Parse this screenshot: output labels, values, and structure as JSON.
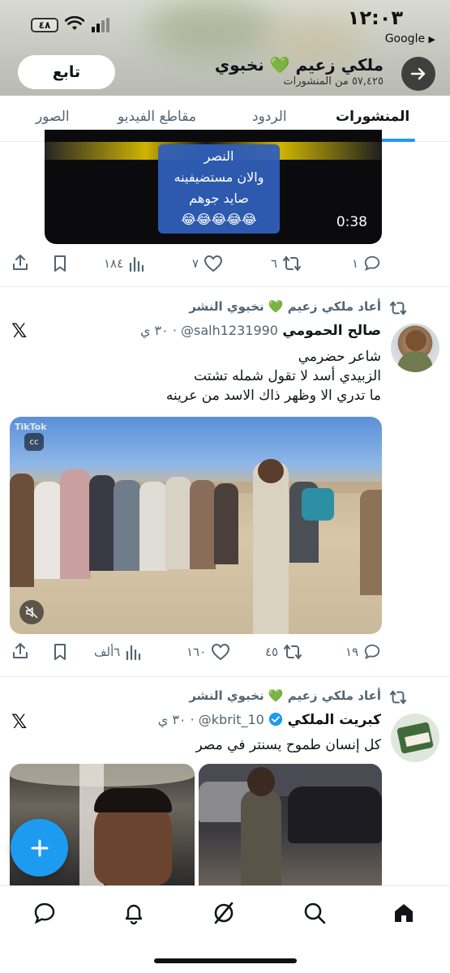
{
  "status_bar": {
    "time": "١٢:٠٣",
    "back_app": "Google",
    "battery": "٤٨"
  },
  "header": {
    "profile_name": "ملكي زعيم 💚 نخبوي",
    "post_count": "٥٧,٤٢٥ من المنشورات",
    "follow_label": "تابع"
  },
  "tabs": [
    {
      "label": "المنشورات",
      "active": true
    },
    {
      "label": "الردود"
    },
    {
      "label": "مقاطع الفيديو"
    },
    {
      "label": "الصور"
    }
  ],
  "post1": {
    "video_caption_lines": [
      "النصر",
      "والان مستضيفينه",
      "صايد جوهم",
      "😂😂😂😂😂"
    ],
    "video_duration": "0:38",
    "replies": "١",
    "reposts": "٦",
    "likes": "٧",
    "views": "١٨٤"
  },
  "post2": {
    "repost_label": "أعاد ملكي زعيم 💚 نخبوي النشر",
    "author_name": "صالح الحمومي",
    "handle_time": "‎@salh1231990 · ٣٠ ي",
    "text_lines": [
      "شاعر حضرمي",
      "الزبيدي أسد لا تقول شمله تشتت",
      "ما تدري الا وظهر ذاك الاسد من عرينه"
    ],
    "video_watermark": "TikTok",
    "replies": "١٩",
    "reposts": "٤٥",
    "likes": "١٦٠",
    "views": "٦ألف"
  },
  "post3": {
    "repost_label": "أعاد ملكي زعيم 💚 نخبوي النشر",
    "author_name": "كبريت الملكي",
    "handle_time": "‎@kbrit_10 · ٣٠ ي",
    "text_lines": [
      "كل إنسان طموح يسنتر في مصر"
    ]
  },
  "colors": {
    "accent": "#1d9bf0",
    "secondary_text": "#536471",
    "primary_text": "#0f1419"
  }
}
